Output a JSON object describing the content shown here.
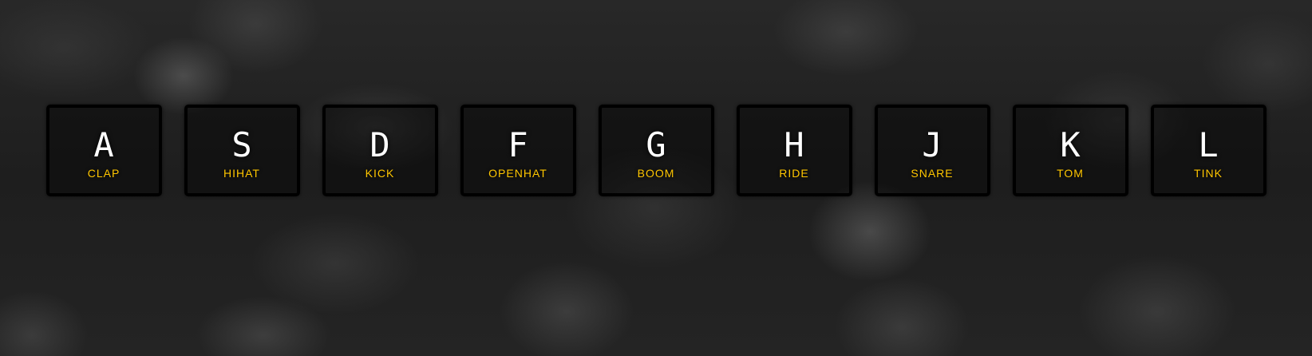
{
  "drum_kit": {
    "keys": [
      {
        "letter": "A",
        "sound": "CLAP"
      },
      {
        "letter": "S",
        "sound": "HIHAT"
      },
      {
        "letter": "D",
        "sound": "KICK"
      },
      {
        "letter": "F",
        "sound": "OPENHAT"
      },
      {
        "letter": "G",
        "sound": "BOOM"
      },
      {
        "letter": "H",
        "sound": "RIDE"
      },
      {
        "letter": "J",
        "sound": "SNARE"
      },
      {
        "letter": "K",
        "sound": "TOM"
      },
      {
        "letter": "L",
        "sound": "TINK"
      }
    ]
  },
  "colors": {
    "sound_label": "#ffc600",
    "key_letter": "#ffffff",
    "key_border": "#000000"
  }
}
